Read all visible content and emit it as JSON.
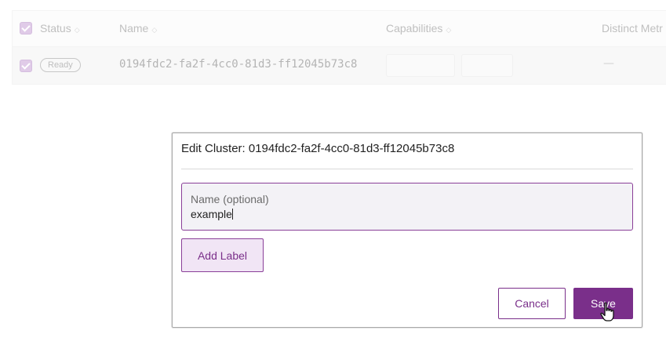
{
  "table": {
    "headers": [
      {
        "label": "Status"
      },
      {
        "label": "Name"
      },
      {
        "label": "Capabilities"
      },
      {
        "label": "Distinct Metr"
      }
    ],
    "row": {
      "status": "Ready",
      "name": "0194fdc2-fa2f-4cc0-81d3-ff12045b73c8",
      "distinct_metrics": "—"
    }
  },
  "modal": {
    "title": "Edit Cluster: 0194fdc2-fa2f-4cc0-81d3-ff12045b73c8",
    "name_field": {
      "label": "Name (optional)",
      "value": "example"
    },
    "add_label_button": "Add Label",
    "cancel_button": "Cancel",
    "save_button": "Save"
  },
  "colors": {
    "accent": "#7a2f8a",
    "accent_light": "#f1e5f5",
    "field_bg": "#f3f2f6"
  },
  "icons": {
    "sort": "sort-icon",
    "cursor": "hand-pointer-icon"
  }
}
